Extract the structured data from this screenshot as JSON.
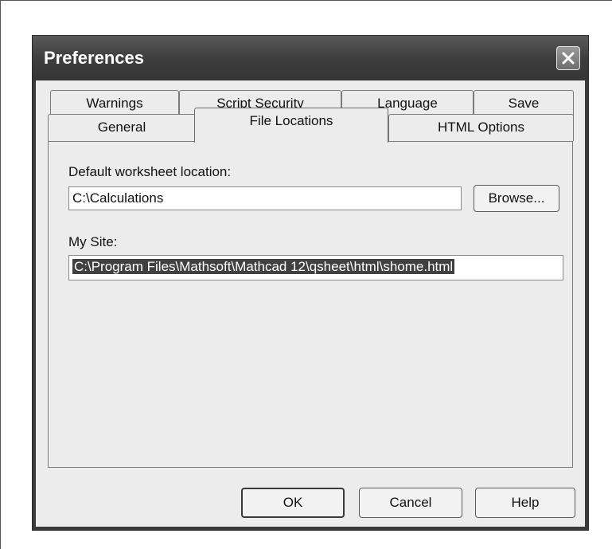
{
  "window": {
    "title": "Preferences"
  },
  "tabs_row1": [
    {
      "label": "Warnings"
    },
    {
      "label": "Script Security"
    },
    {
      "label": "Language"
    },
    {
      "label": "Save"
    }
  ],
  "tabs_row2": [
    {
      "label": "General"
    },
    {
      "label": "File Locations"
    },
    {
      "label": "HTML Options"
    }
  ],
  "active_tab": "File Locations",
  "panel": {
    "default_location_label": "Default worksheet location:",
    "default_location_value": "C:\\Calculations",
    "browse_label": "Browse...",
    "my_site_label": "My Site:",
    "my_site_value": "C:\\Program Files\\Mathsoft\\Mathcad 12\\qsheet\\html\\shome.html"
  },
  "buttons": {
    "ok": "OK",
    "cancel": "Cancel",
    "help": "Help"
  },
  "icons": {
    "close": "close-x-icon"
  }
}
